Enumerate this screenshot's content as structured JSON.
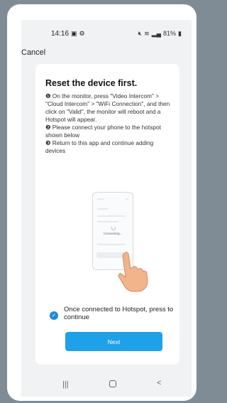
{
  "status": {
    "time": "14:16",
    "left_icons": [
      "photo-icon",
      "settings-icon"
    ],
    "right_icons": [
      "mute-icon",
      "wifi-icon",
      "signal-icon"
    ],
    "battery": "81%"
  },
  "header": {
    "cancel_label": "Cancel"
  },
  "card": {
    "title": "Reset the device first.",
    "steps": [
      "❶ On the monitor, press \"Video Intercom\" > \"Cloud Intercom\" > \"WiFi Connection\", and then click on \"Valid\", the monitor will reboot and a Hotspot will appear.",
      "❷ Please connect your phone to the hotspot shown below",
      "❸ Return to this app and continue adding devices"
    ],
    "illustration": {
      "mini_text": "Connecting..."
    },
    "checkbox": {
      "checked": true,
      "label": "Once connected to Hotspot, press to continue"
    },
    "next_label": "Next"
  },
  "navbar": {
    "recent": "|||",
    "back": "<"
  },
  "colors": {
    "accent": "#1ea1e8",
    "check": "#1e88e5",
    "background": "#7f8c96"
  }
}
